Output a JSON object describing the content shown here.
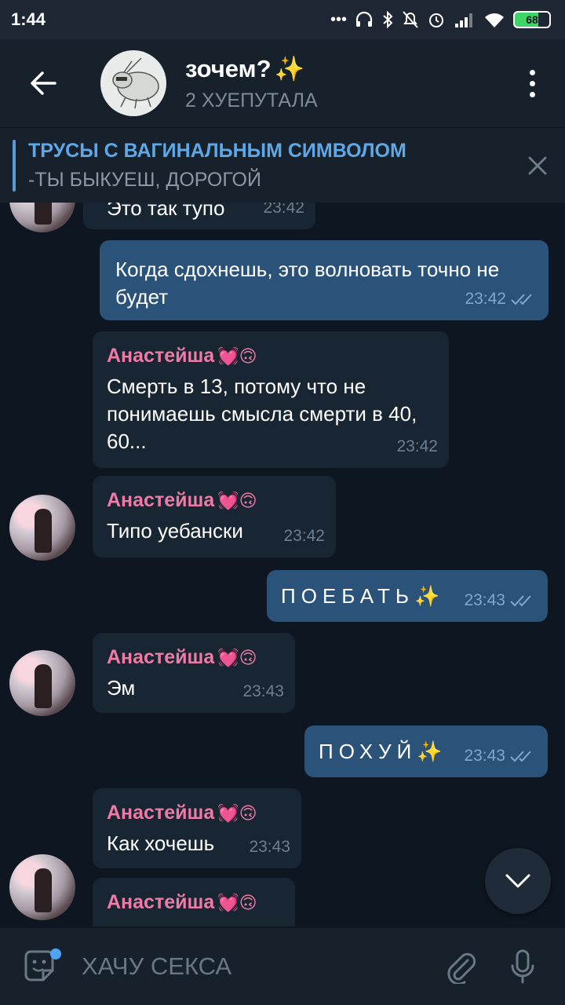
{
  "status_bar": {
    "time": "1:44",
    "battery": "68"
  },
  "header": {
    "title": "зочем?",
    "title_emoji": "✨",
    "subtitle": "2 ХУЕПУТАЛА"
  },
  "pinned": {
    "title": "ТРУСЫ С ВАГИНАЛЬНЫМ СИМВОЛОМ",
    "body": "-ТЫ БЫКУЕШ, ДОРОГОЙ"
  },
  "messages": [
    {
      "direction": "in",
      "text": "Это так тупо",
      "time": "23:42"
    },
    {
      "direction": "out",
      "text": "Когда сдохнешь, это волновать точно не будет",
      "time": "23:42"
    },
    {
      "direction": "in",
      "sender": "Анастейша",
      "sender_emoji": "💓🙃",
      "text": "Смерть в 13, потому что не понимаешь смысла смерти в 40, 60...",
      "time": "23:42"
    },
    {
      "direction": "in",
      "sender": "Анастейша",
      "sender_emoji": "💓🙃",
      "text": "Типо уебански",
      "time": "23:42"
    },
    {
      "direction": "out",
      "text": "ПОЕБАТЬ✨",
      "time": "23:43"
    },
    {
      "direction": "in",
      "sender": "Анастейша",
      "sender_emoji": "💓🙃",
      "text": "Эм",
      "time": "23:43"
    },
    {
      "direction": "out",
      "text": "ПОХУЙ✨",
      "time": "23:43"
    },
    {
      "direction": "in",
      "sender": "Анастейша",
      "sender_emoji": "💓🙃",
      "text": "Как хочешь",
      "time": "23:43"
    },
    {
      "direction": "in",
      "sender": "Анастейша",
      "sender_emoji": "💓🙃",
      "text": "",
      "time": ""
    }
  ],
  "composer": {
    "placeholder": "ХАЧУ СЕКСА"
  },
  "colors": {
    "background": "#0e1621",
    "bar": "#17212b",
    "incoming": "#182533",
    "outgoing": "#2b5278",
    "sender_name": "#ee7aa6",
    "accent": "#5fa8e8"
  }
}
